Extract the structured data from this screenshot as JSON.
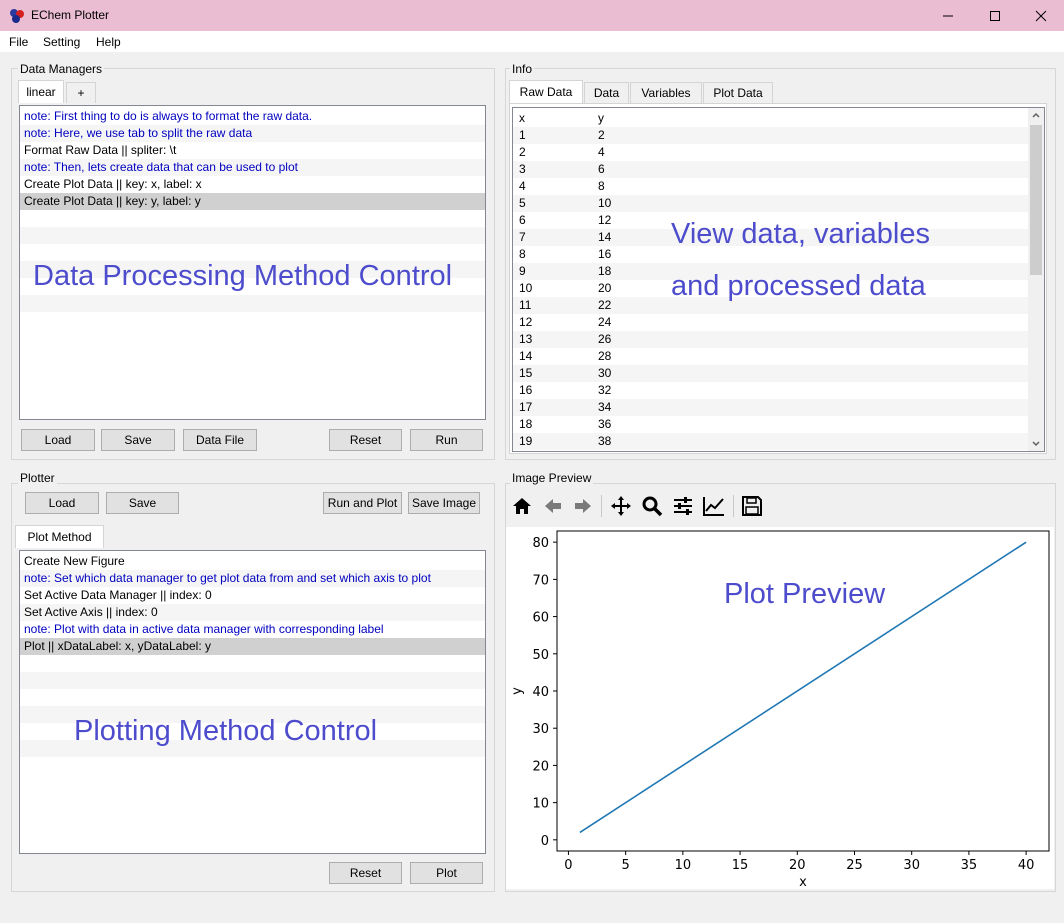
{
  "window": {
    "title": "EChem Plotter"
  },
  "menu": [
    "File",
    "Setting",
    "Help"
  ],
  "data_managers": {
    "group_title": "Data Managers",
    "tabs": [
      "linear",
      "+"
    ],
    "rows": [
      {
        "text": "note: First thing to do is always to format the raw data.",
        "type": "note"
      },
      {
        "text": "note: Here, we use tab to split the raw data",
        "type": "note"
      },
      {
        "text": "Format Raw Data || spliter: \\t",
        "type": "action"
      },
      {
        "text": "note: Then, lets create data that can be used to plot",
        "type": "note"
      },
      {
        "text": "Create Plot Data || key: x, label: x",
        "type": "action"
      },
      {
        "text": "Create Plot Data || key: y, label: y",
        "type": "action",
        "selected": true
      }
    ],
    "overlay": "Data Processing Method Control",
    "buttons": {
      "load": "Load",
      "save": "Save",
      "data_file": "Data File",
      "reset": "Reset",
      "run": "Run"
    }
  },
  "info": {
    "group_title": "Info",
    "tabs": [
      "Raw Data",
      "Data",
      "Variables",
      "Plot Data"
    ],
    "columns": [
      "x",
      "y"
    ],
    "rows": [
      [
        "1",
        "2"
      ],
      [
        "2",
        "4"
      ],
      [
        "3",
        "6"
      ],
      [
        "4",
        "8"
      ],
      [
        "5",
        "10"
      ],
      [
        "6",
        "12"
      ],
      [
        "7",
        "14"
      ],
      [
        "8",
        "16"
      ],
      [
        "9",
        "18"
      ],
      [
        "10",
        "20"
      ],
      [
        "11",
        "22"
      ],
      [
        "12",
        "24"
      ],
      [
        "13",
        "26"
      ],
      [
        "14",
        "28"
      ],
      [
        "15",
        "30"
      ],
      [
        "16",
        "32"
      ],
      [
        "17",
        "34"
      ],
      [
        "18",
        "36"
      ],
      [
        "19",
        "38"
      ]
    ],
    "overlay_line1": "View data, variables",
    "overlay_line2": "and processed data"
  },
  "plotter": {
    "group_title": "Plotter",
    "buttons": {
      "load": "Load",
      "save": "Save",
      "run_and_plot": "Run and Plot",
      "save_image": "Save Image",
      "reset": "Reset",
      "plot": "Plot"
    },
    "tab": "Plot Method",
    "rows": [
      {
        "text": "Create New Figure",
        "type": "action"
      },
      {
        "text": "note: Set which data manager to get plot data from and set which axis to plot",
        "type": "note"
      },
      {
        "text": "Set Active Data Manager || index: 0",
        "type": "action"
      },
      {
        "text": "Set Active Axis || index: 0",
        "type": "action"
      },
      {
        "text": "note: Plot with data in active data manager with corresponding label",
        "type": "note"
      },
      {
        "text": "Plot || xDataLabel: x, yDataLabel: y",
        "type": "action",
        "selected": true
      }
    ],
    "overlay": "Plotting Method Control"
  },
  "image_preview": {
    "group_title": "Image Preview",
    "toolbar": [
      "home-icon",
      "back-icon",
      "forward-icon",
      "pan-icon",
      "zoom-icon",
      "configure-subplots-icon",
      "edit-axis-icon",
      "save-figure-icon"
    ],
    "overlay": "Plot Preview"
  },
  "chart_data": {
    "type": "line",
    "title": "",
    "xlabel": "x",
    "ylabel": "y",
    "xlim": [
      -1,
      42
    ],
    "ylim": [
      -3,
      83
    ],
    "xticks": [
      0,
      5,
      10,
      15,
      20,
      25,
      30,
      35,
      40
    ],
    "yticks": [
      0,
      10,
      20,
      30,
      40,
      50,
      60,
      70,
      80
    ],
    "grid": false,
    "series": [
      {
        "color": "#1f77b4",
        "x": [
          1,
          40
        ],
        "y": [
          2,
          80
        ]
      }
    ]
  }
}
